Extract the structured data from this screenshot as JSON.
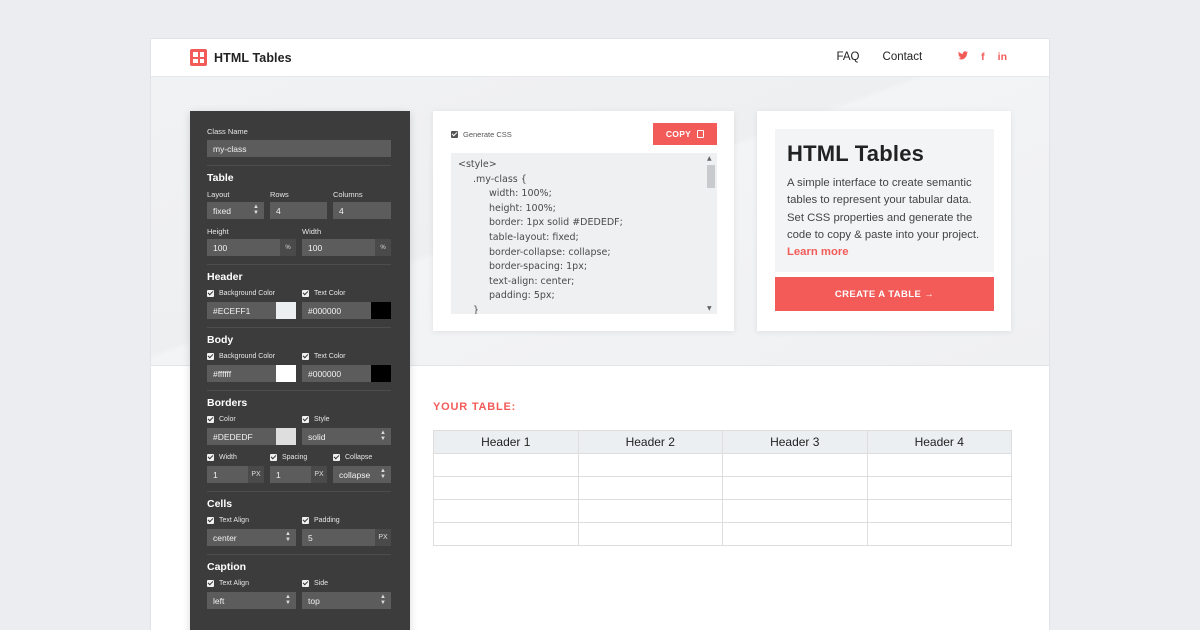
{
  "nav": {
    "brand": "HTML Tables",
    "links": [
      "FAQ",
      "Contact"
    ],
    "social": [
      {
        "icon": "twitter-icon",
        "glyph": "𝕥"
      },
      {
        "icon": "facebook-icon",
        "glyph": "f"
      },
      {
        "icon": "linkedin-icon",
        "glyph": "in"
      }
    ]
  },
  "panel": {
    "class_name": {
      "label": "Class Name",
      "value": "my-class"
    },
    "table": {
      "title": "Table",
      "layout": {
        "label": "Layout",
        "value": "fixed"
      },
      "rows": {
        "label": "Rows",
        "value": "4"
      },
      "columns": {
        "label": "Columns",
        "value": "4"
      },
      "height": {
        "label": "Height",
        "value": "100",
        "unit": "%"
      },
      "width": {
        "label": "Width",
        "value": "100",
        "unit": "%"
      }
    },
    "header": {
      "title": "Header",
      "bg": {
        "label": "Background Color",
        "value": "#ECEFF1",
        "swatch": "#ECEFF1"
      },
      "text": {
        "label": "Text Color",
        "value": "#000000",
        "swatch": "#000000"
      }
    },
    "body": {
      "title": "Body",
      "bg": {
        "label": "Background Color",
        "value": "#ffffff",
        "swatch": "#ffffff"
      },
      "text": {
        "label": "Text Color",
        "value": "#000000",
        "swatch": "#000000"
      }
    },
    "borders": {
      "title": "Borders",
      "color": {
        "label": "Color",
        "value": "#DEDEDF",
        "swatch": "#DEDEDF"
      },
      "style": {
        "label": "Style",
        "value": "solid"
      },
      "width": {
        "label": "Width",
        "value": "1",
        "unit": "PX"
      },
      "spacing": {
        "label": "Spacing",
        "value": "1",
        "unit": "PX"
      },
      "collapse": {
        "label": "Collapse",
        "value": "collapse"
      }
    },
    "cells": {
      "title": "Cells",
      "align": {
        "label": "Text Align",
        "value": "center"
      },
      "padding": {
        "label": "Padding",
        "value": "5",
        "unit": "PX"
      }
    },
    "caption": {
      "title": "Caption",
      "align": {
        "label": "Text Align",
        "value": "left"
      },
      "side": {
        "label": "Side",
        "value": "top"
      }
    }
  },
  "code": {
    "generate_label": "Generate CSS",
    "copy_label": "COPY",
    "lines": [
      "<style>",
      ".my-class {",
      "width: 100%;",
      "height: 100%;",
      "border: 1px solid #DEDEDF;",
      "table-layout: fixed;",
      "border-collapse: collapse;",
      "border-spacing: 1px;",
      "text-align: center;",
      "padding: 5px;",
      "}"
    ]
  },
  "info": {
    "title": "HTML Tables",
    "description": "A simple interface to create semantic tables to represent your tabular data. Set CSS properties and generate the code to copy & paste into your project.",
    "learn_more": "Learn more",
    "cta": "CREATE A TABLE →"
  },
  "preview": {
    "title": "YOUR TABLE:",
    "headers": [
      "Header 1",
      "Header 2",
      "Header 3",
      "Header 4"
    ],
    "rows": [
      [
        "",
        "",
        "",
        ""
      ],
      [
        "",
        "",
        "",
        ""
      ],
      [
        "",
        "",
        "",
        ""
      ],
      [
        "",
        "",
        "",
        ""
      ]
    ]
  },
  "colors": {
    "accent": "#f25b58",
    "panel": "#3c3c3c",
    "field": "#5c5c5c"
  }
}
